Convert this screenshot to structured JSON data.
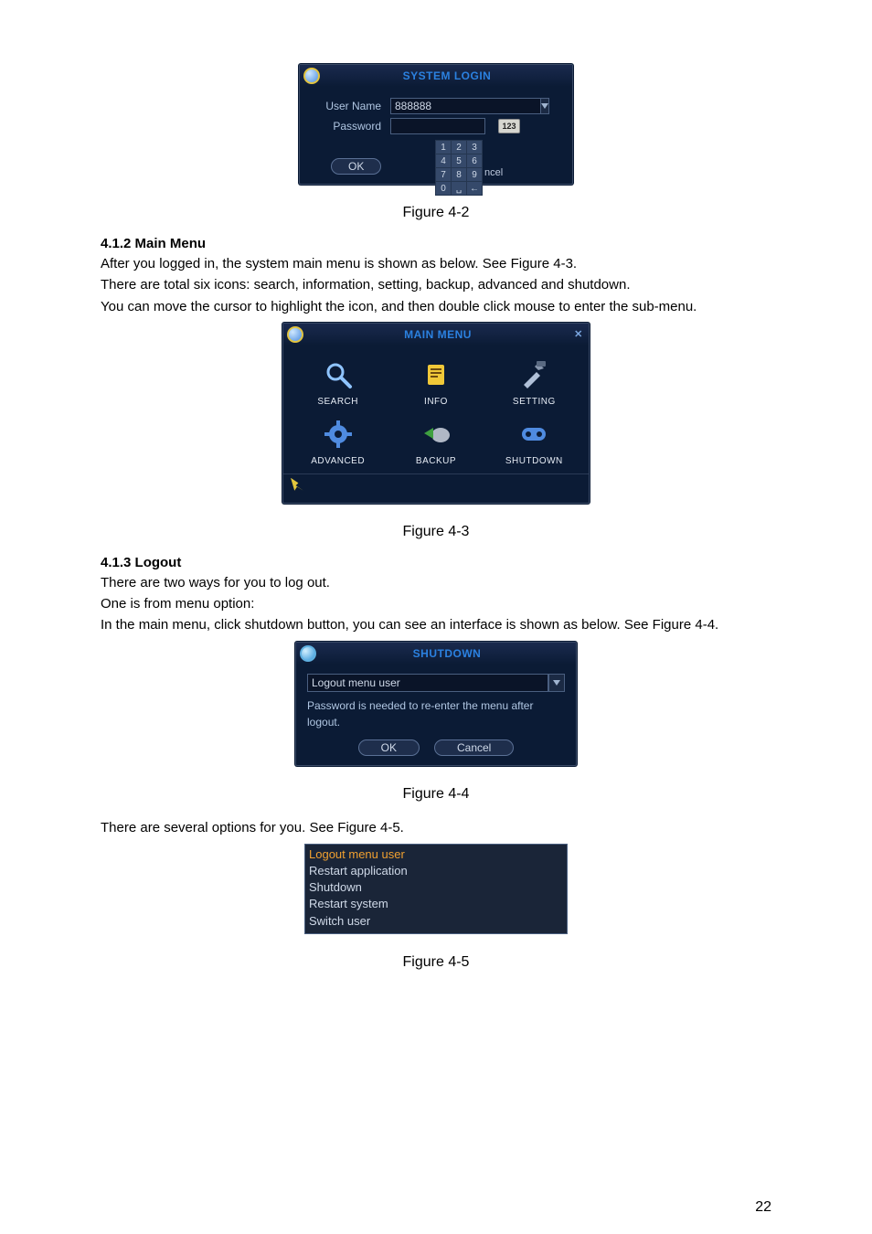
{
  "pageNumber": "22",
  "fig42": {
    "title": "SYSTEM LOGIN",
    "userNameLabel": "User Name",
    "passwordLabel": "Password",
    "userNameValue": "888888",
    "okLabel": "OK",
    "remnant": "ncel",
    "oskBadge": "123",
    "keypad": [
      "1",
      "2",
      "3",
      "4",
      "5",
      "6",
      "7",
      "8",
      "9",
      "0",
      "␣",
      "←"
    ],
    "caption": "Figure 4-2"
  },
  "sec412": {
    "heading": "4.1.2   Main Menu",
    "p1": "After you logged in, the system main menu is shown as below. See Figure 4-3.",
    "p2": "There are total six icons: search, information, setting, backup, advanced and shutdown.",
    "p3": "You can move the cursor to highlight the icon, and then double click mouse to enter the sub-menu."
  },
  "fig43": {
    "title": "MAIN MENU",
    "items": [
      "SEARCH",
      "INFO",
      "SETTING",
      "ADVANCED",
      "BACKUP",
      "SHUTDOWN"
    ],
    "caption": "Figure 4-3"
  },
  "sec413": {
    "heading": "4.1.3   Logout",
    "p1": "There are two ways for you to log out.",
    "p2": "One is from menu option:",
    "p3": "In the main menu, click shutdown button, you can see an interface is shown as below.  See Figure 4-4."
  },
  "fig44": {
    "title": "SHUTDOWN",
    "selected": "Logout menu user",
    "note": "Password is needed to re-enter the menu after logout.",
    "ok": "OK",
    "cancel": "Cancel",
    "caption": "Figure 4-4"
  },
  "sec45_intro": "There are several options for you. See Figure 4-5.",
  "fig45": {
    "options": [
      "Logout menu user",
      "Restart application",
      "Shutdown",
      "Restart system",
      "Switch user"
    ],
    "caption": "Figure 4-5"
  }
}
